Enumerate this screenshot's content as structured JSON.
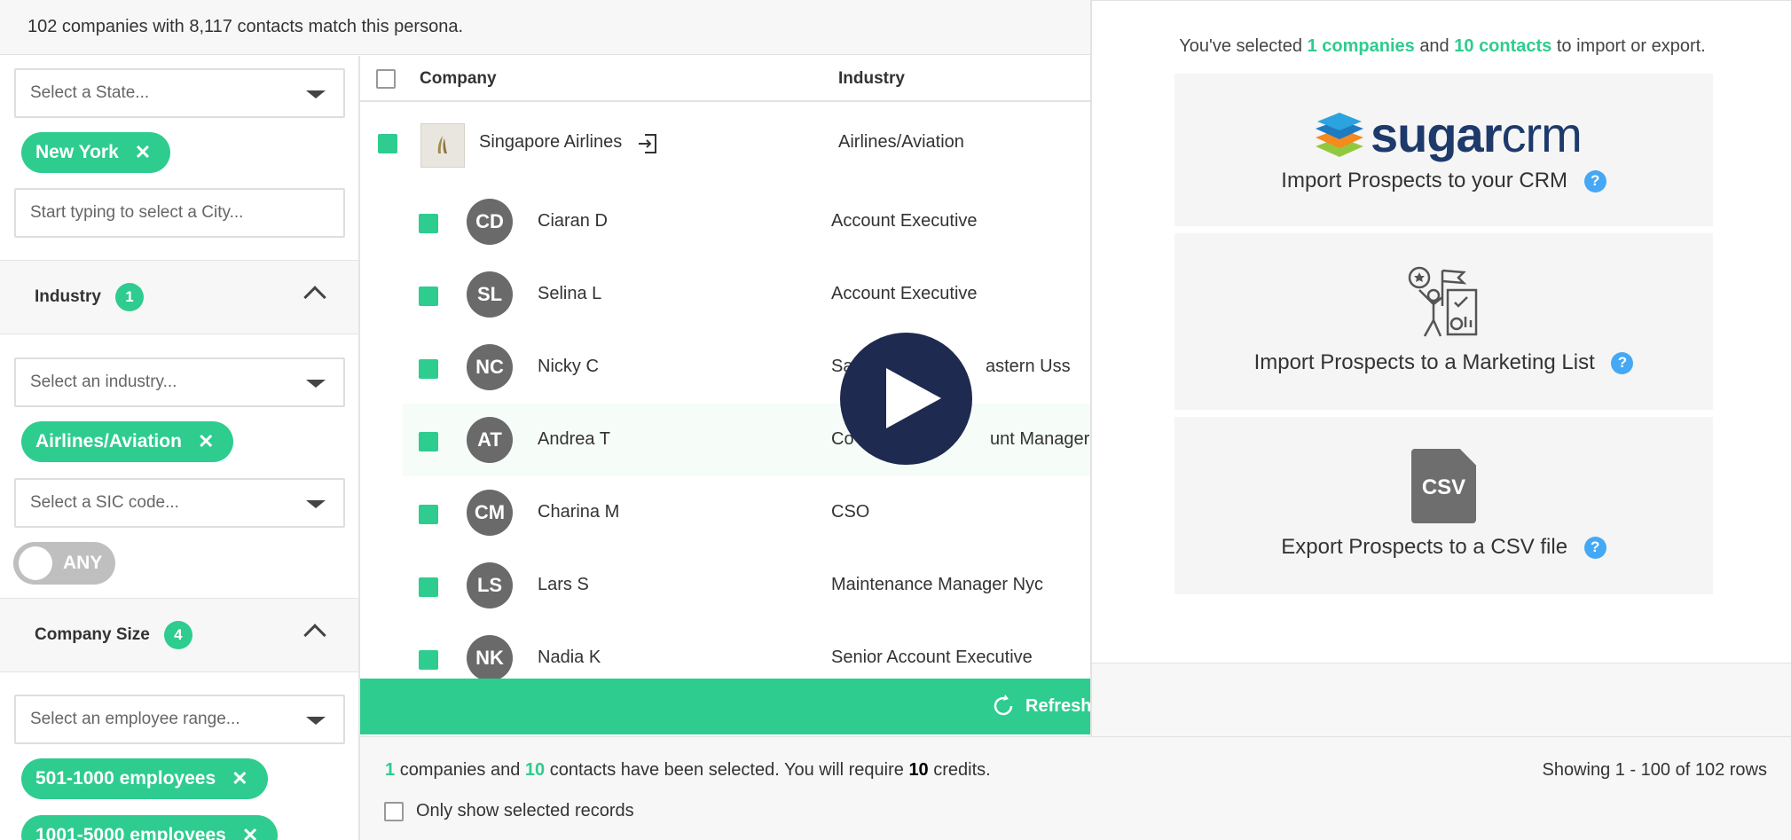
{
  "summary": "102 companies with 8,117 contacts match this persona.",
  "filters": {
    "state_placeholder": "Select a State...",
    "state_tags": [
      {
        "label": "New York"
      }
    ],
    "city_placeholder": "Start typing to select a City...",
    "industry": {
      "title": "Industry",
      "count": "1",
      "placeholder": "Select an industry...",
      "tags": [
        {
          "label": "Airlines/Aviation"
        }
      ],
      "sic_placeholder": "Select a SIC code...",
      "toggle_label": "ANY"
    },
    "company_size": {
      "title": "Company Size",
      "count": "4",
      "placeholder": "Select an employee range...",
      "tags": [
        {
          "label": "501-1000 employees"
        },
        {
          "label": "1001-5000 employees"
        }
      ]
    },
    "remove_glyph": "✕"
  },
  "table": {
    "columns": [
      "Company",
      "Industry"
    ],
    "company": {
      "name": "Singapore Airlines",
      "industry": "Airlines/Aviation",
      "logo_icon": "singapore-airlines-logo",
      "link_icon": "open-link-icon"
    },
    "contacts": [
      {
        "initials": "CD",
        "name": "Ciaran D",
        "title": "Account Executive"
      },
      {
        "initials": "SL",
        "name": "Selina L",
        "title": "Account Executive"
      },
      {
        "initials": "NC",
        "name": "Nicky C",
        "title": "Sa",
        "title_tail": "astern Uss"
      },
      {
        "initials": "AT",
        "name": "Andrea T",
        "title": "Co",
        "title_tail": "unt Manager"
      },
      {
        "initials": "CM",
        "name": "Charina M",
        "title": "CSO"
      },
      {
        "initials": "LS",
        "name": "Lars S",
        "title": "Maintenance Manager Nyc"
      },
      {
        "initials": "NK",
        "name": "Nadia K",
        "title": "Senior Account Executive"
      }
    ],
    "refresh_label": "Refresh"
  },
  "right_panel": {
    "selection": {
      "pre": "You've selected",
      "companies_num": "1",
      "companies_word": "companies",
      "and": "and",
      "contacts_num": "10",
      "contacts_word": "contacts",
      "post": "to import or export."
    },
    "crm_brand": {
      "sugar": "sugar",
      "crm": "crm"
    },
    "options": [
      {
        "label": "Import Prospects to your CRM",
        "icon": "sugarcrm-logo"
      },
      {
        "label": "Import Prospects to a Marketing List",
        "icon": "marketing-team-icon"
      },
      {
        "label": "Export Prospects to a CSV file",
        "icon": "csv-file-icon",
        "icon_text": "CSV"
      }
    ],
    "help_glyph": "?"
  },
  "status": {
    "companies_num": "1",
    "companies_text": "companies and",
    "contacts_num": "10",
    "contacts_text": "contacts have been selected. You will require",
    "credits_num": "10",
    "credits_text": "credits.",
    "rows": "Showing 1 - 100 of 102 rows",
    "only_selected": "Only show selected records"
  },
  "colors": {
    "accent": "#2ecc8f",
    "avatar": "#6a6a6a",
    "play": "#1e2a4f",
    "help": "#45a8f4",
    "brand_navy": "#1d3a6b"
  }
}
